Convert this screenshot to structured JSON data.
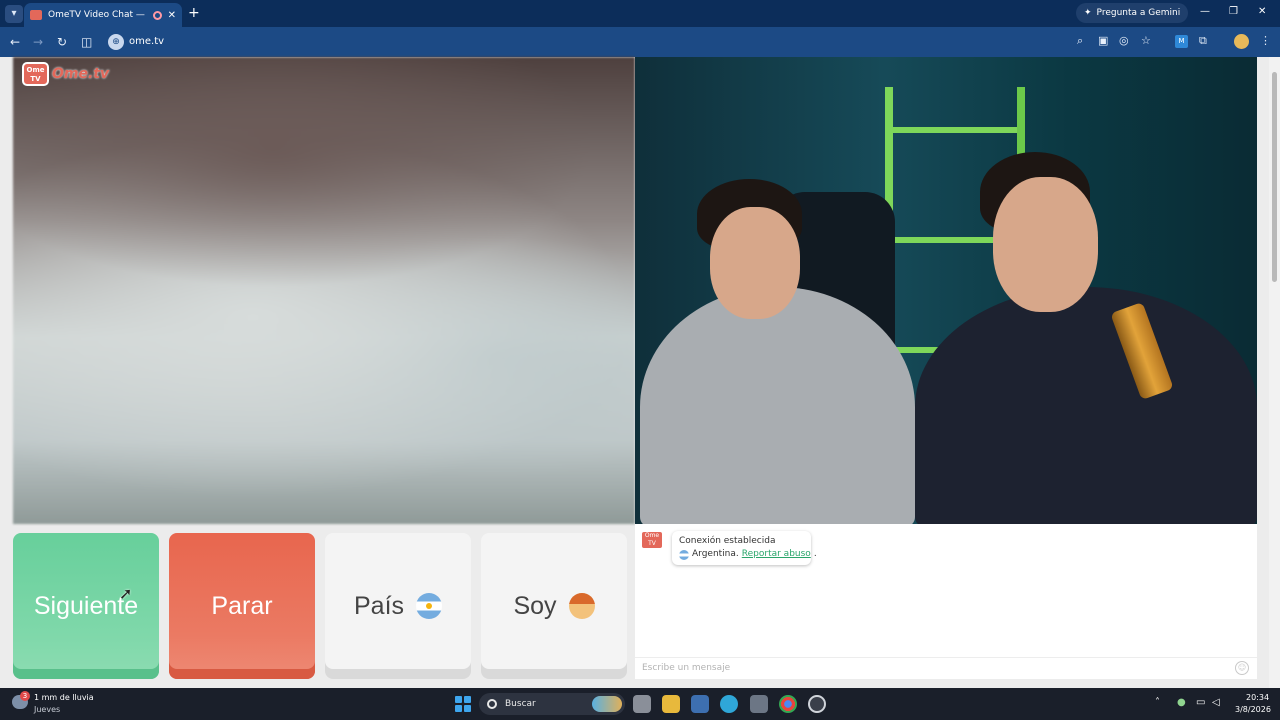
{
  "browser": {
    "tab_title": "OmeTV Video Chat — Omegle",
    "tab_close": "✕",
    "new_tab": "+",
    "gemini_label": "Pregunta a Gemini",
    "url": "ome.tv",
    "window_controls": [
      "—",
      "❐",
      "✕"
    ],
    "menu_icon": "⋮"
  },
  "site": {
    "logo_badge": "Ome TV",
    "logo_text": "Ome.tv"
  },
  "controls": {
    "next_label": "Siguiente",
    "stop_label": "Parar",
    "country_label": "País",
    "gender_label": "Soy",
    "country_flag": "argentina-flag-icon",
    "gender_icon": "boy-icon"
  },
  "chat": {
    "status_title": "Conexión establecida",
    "country": "Argentina.",
    "report_link": "Reportar abuso",
    "report_suffix": ".",
    "input_placeholder": "Escribe un mensaje",
    "emoji_icon": "☺"
  },
  "taskbar": {
    "weather_badge": "3",
    "weather_text": "1 mm de lluvia",
    "weather_day": "Jueves",
    "search_label": "Buscar",
    "time": "20:34",
    "date": "3/8/2026"
  },
  "colors": {
    "next_green": "#67cf9b",
    "stop_red": "#e8664e",
    "brand": "#e3685a",
    "link": "#2aa66b"
  }
}
